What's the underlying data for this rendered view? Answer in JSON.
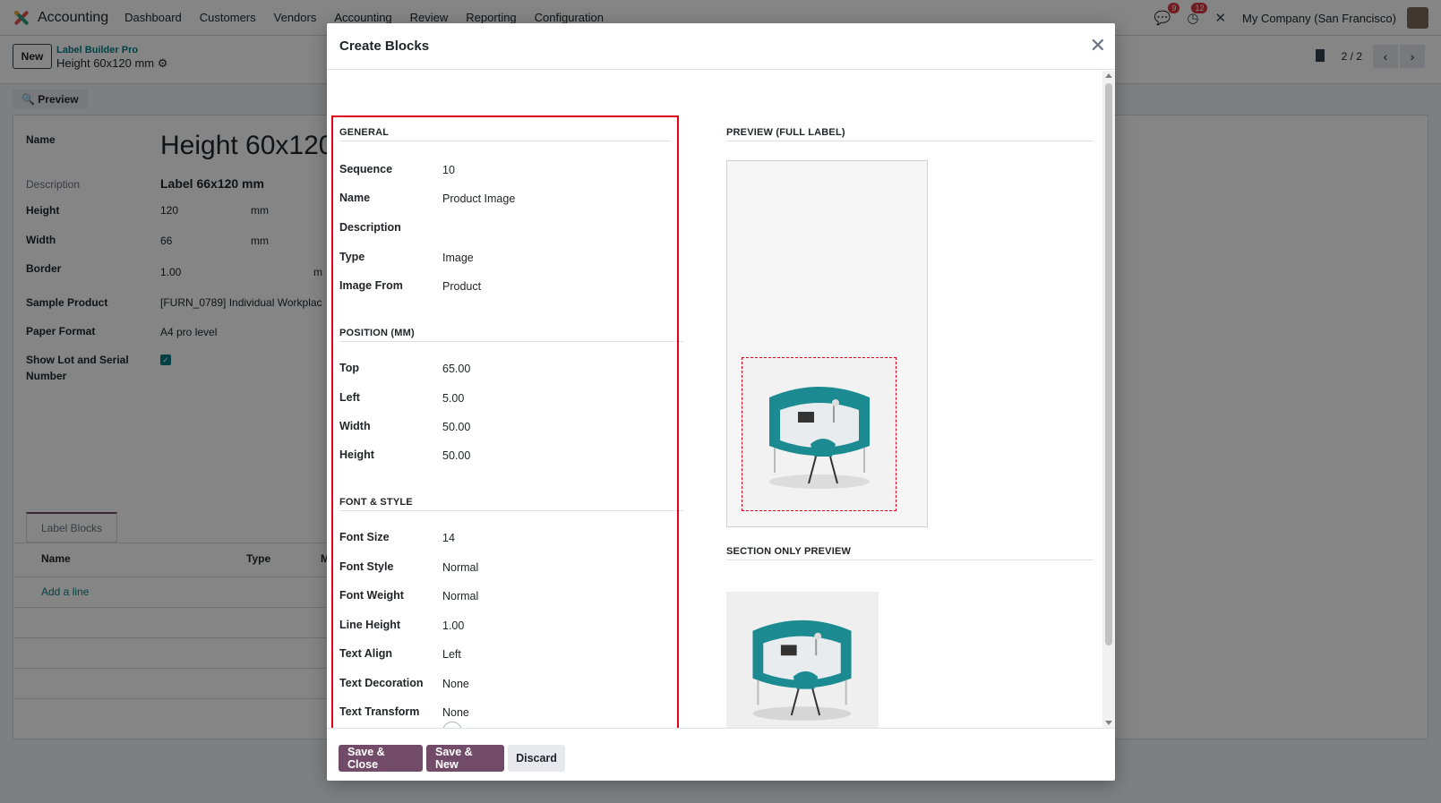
{
  "app": {
    "name": "Accounting",
    "menu": [
      "Dashboard",
      "Customers",
      "Vendors",
      "Accounting",
      "Review",
      "Reporting",
      "Configuration"
    ],
    "chat_badge": "9",
    "activity_badge": "12",
    "company": "My Company (San Francisco)"
  },
  "control": {
    "new_label": "New",
    "breadcrumb_parent": "Label Builder Pro",
    "breadcrumb_current": "Height 60x120 mm",
    "pager": "2 / 2",
    "preview_label": "Preview"
  },
  "form": {
    "name_label": "Name",
    "name_value": "Height 60x120",
    "description_label": "Description",
    "description_value": "Label 66x120 mm",
    "height_label": "Height",
    "height_value": "120",
    "height_unit": "mm",
    "width_label": "Width",
    "width_value": "66",
    "width_unit": "mm",
    "border_label": "Border",
    "border_value": "1.00",
    "border_unit": "m",
    "sample_product_label": "Sample Product",
    "sample_product_value": "[FURN_0789] Individual Workplac",
    "paper_format_label": "Paper Format",
    "paper_format_value": "A4 pro level",
    "show_lot_label_1": "Show Lot and Serial",
    "show_lot_label_2": "Number",
    "tab_label": "Label Blocks",
    "col_name": "Name",
    "col_type": "Type",
    "col_m": "M",
    "add_line": "Add a line"
  },
  "modal": {
    "title": "Create Blocks",
    "general": {
      "title": "GENERAL",
      "fields": [
        {
          "label": "Sequence",
          "value": "10"
        },
        {
          "label": "Name",
          "value": "Product Image"
        },
        {
          "label": "Description",
          "value": ""
        },
        {
          "label": "Type",
          "value": "Image"
        },
        {
          "label": "Image From",
          "value": "Product"
        }
      ]
    },
    "position": {
      "title": "POSITION (MM)",
      "fields": [
        {
          "label": "Top",
          "value": "65.00"
        },
        {
          "label": "Left",
          "value": "5.00"
        },
        {
          "label": "Width",
          "value": "50.00"
        },
        {
          "label": "Height",
          "value": "50.00"
        }
      ]
    },
    "font": {
      "title": "FONT & STYLE",
      "fields": [
        {
          "label": "Font Size",
          "value": "14"
        },
        {
          "label": "Font Style",
          "value": "Normal"
        },
        {
          "label": "Font Weight",
          "value": "Normal"
        },
        {
          "label": "Line Height",
          "value": "1.00"
        },
        {
          "label": "Text Align",
          "value": "Left"
        },
        {
          "label": "Text Decoration",
          "value": "None"
        },
        {
          "label": "Text Transform",
          "value": "None"
        }
      ]
    },
    "preview_full_title": "PREVIEW (FULL LABEL)",
    "preview_section_title": "SECTION ONLY PREVIEW",
    "buttons": {
      "save_close": "Save & Close",
      "save_new": "Save & New",
      "discard": "Discard"
    }
  },
  "colors": {
    "brand": "#714b67",
    "highlight": "#e3001b",
    "teal": "#1b8a91"
  }
}
